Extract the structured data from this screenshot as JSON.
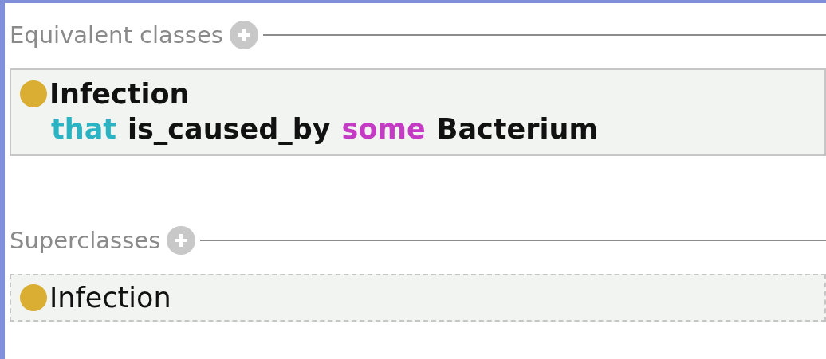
{
  "sections": [
    {
      "title": "Equivalent classes",
      "items": [
        {
          "selected": true,
          "bold": true,
          "lines": [
            [
              {
                "kind": "class",
                "text": "Infection"
              }
            ],
            [
              {
                "kind": "keyword",
                "text": "that"
              },
              {
                "kind": "property",
                "text": "is_caused_by"
              },
              {
                "kind": "quantifier",
                "text": "some"
              },
              {
                "kind": "class",
                "text": "Bacterium"
              }
            ]
          ]
        }
      ]
    },
    {
      "title": "Superclasses",
      "items": [
        {
          "selected": false,
          "bold": false,
          "lines": [
            [
              {
                "kind": "class",
                "text": "Infection"
              }
            ]
          ]
        }
      ]
    }
  ]
}
